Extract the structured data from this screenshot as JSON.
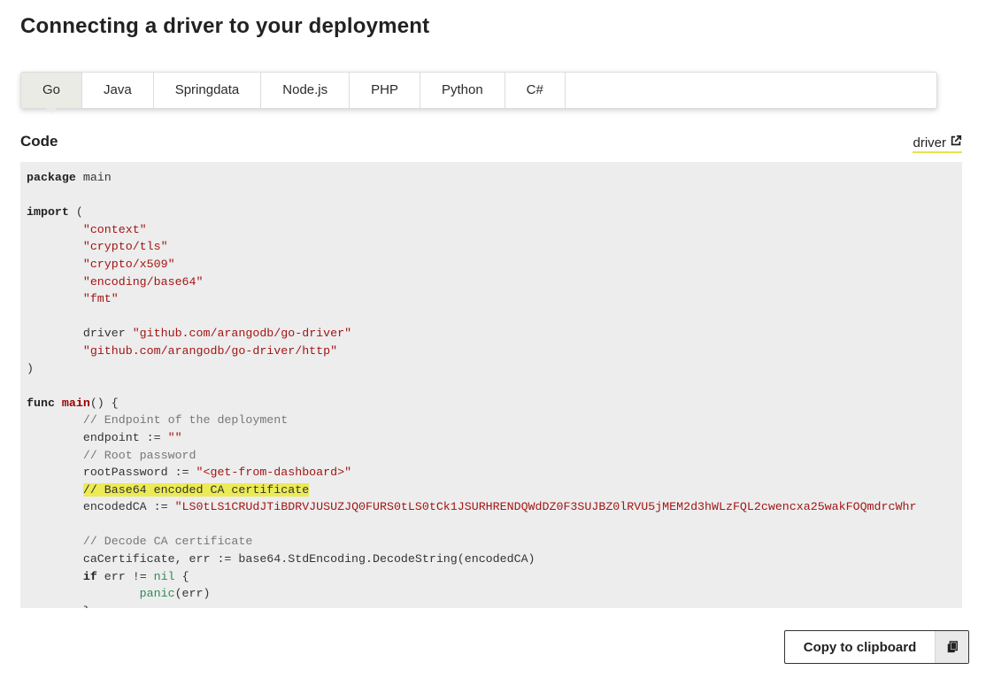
{
  "page": {
    "title": "Connecting a driver to your deployment"
  },
  "tabs": [
    {
      "label": "Go",
      "active": true
    },
    {
      "label": "Java",
      "active": false
    },
    {
      "label": "Springdata",
      "active": false
    },
    {
      "label": "Node.js",
      "active": false
    },
    {
      "label": "PHP",
      "active": false
    },
    {
      "label": "Python",
      "active": false
    },
    {
      "label": "C#",
      "active": false
    }
  ],
  "code_section": {
    "heading": "Code",
    "driver_link": {
      "label": "driver",
      "icon": "external-link-icon"
    }
  },
  "code": {
    "package_kw": "package",
    "package_name": " main",
    "import_kw": "import",
    "import_open": " (",
    "imports": [
      "\"context\"",
      "\"crypto/tls\"",
      "\"crypto/x509\"",
      "\"encoding/base64\"",
      "\"fmt\""
    ],
    "driver_alias": "driver ",
    "driver_import": "\"github.com/arangodb/go-driver\"",
    "http_import": "\"github.com/arangodb/go-driver/http\"",
    "import_close": ")",
    "func_kw": "func",
    "func_name": "main",
    "func_rest": "() {",
    "comment_endpoint": "// Endpoint of the deployment",
    "endpoint_decl": "endpoint := ",
    "endpoint_value": "\"\"",
    "comment_root": "// Root password",
    "root_decl": "rootPassword := ",
    "root_value": "\"<get-from-dashboard>\"",
    "comment_base64": "// Base64 encoded CA certificate",
    "ca_decl": "encodedCA := ",
    "ca_value": "\"LS0tLS1CRUdJTiBDRVJUSUZJQ0FURS0tLS0tCk1JSURHRENDQWdDZ0F3SUJBZ0lRVU5jMEM2d3hWLzFQL2cwencxa25wakFOQmdrcWhr",
    "comment_decode": "// Decode CA certificate",
    "decode_line": "caCertificate, err := base64.StdEncoding.DecodeString(encodedCA)",
    "if_kw": "if",
    "if_cond": " err != ",
    "nil_kw": "nil",
    "if_open": " {",
    "panic_fn": "panic",
    "panic_args": "(err)",
    "close_brace": "}"
  },
  "copy_button": {
    "label": "Copy to clipboard",
    "icon": "clipboard-icon"
  }
}
